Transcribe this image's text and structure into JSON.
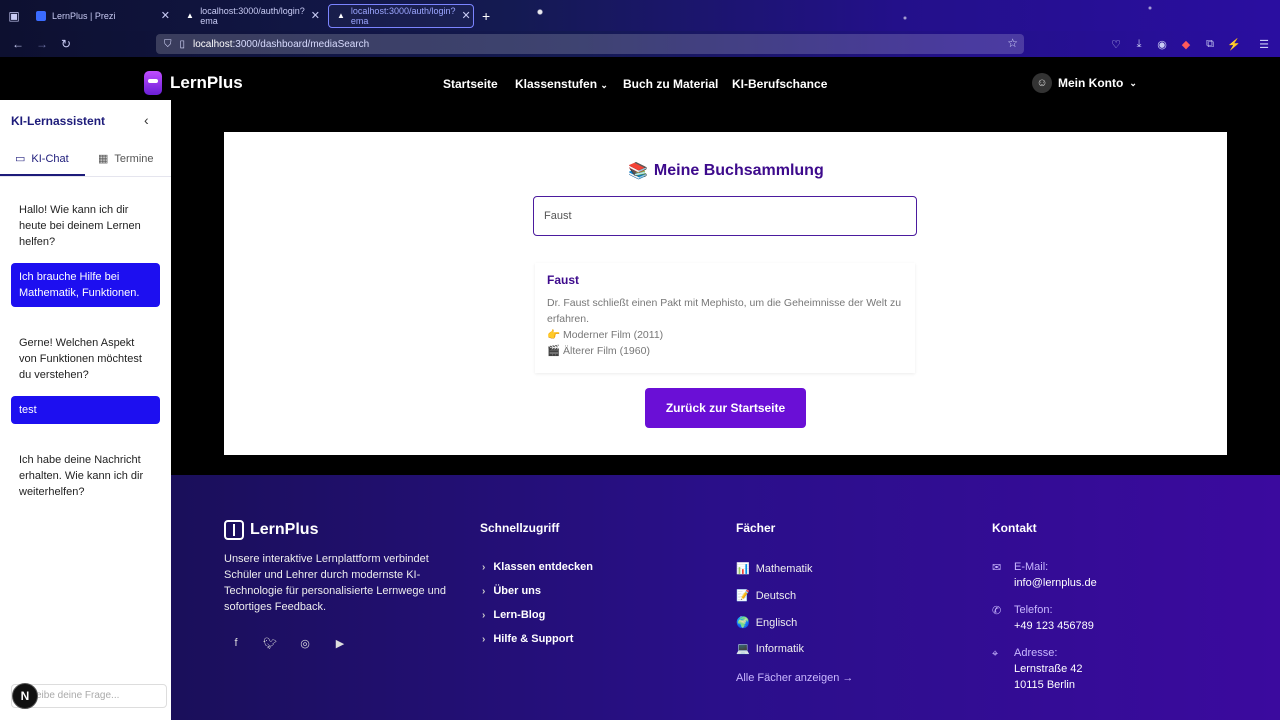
{
  "browser": {
    "tabs": [
      {
        "label": "LernPlus | Prezi",
        "active": false
      },
      {
        "label": "localhost:3000/auth/login?ema",
        "active": false
      },
      {
        "label": "localhost:3000/auth/login?ema",
        "active": true
      }
    ],
    "url_host": "localhost",
    "url_path": ":3000/dashboard/mediaSearch",
    "colors": {
      "chrome": "#141a52",
      "tab_active_border": "#7b84ff"
    }
  },
  "header": {
    "brand": "LernPlus",
    "nav": [
      "Startseite",
      "Klassenstufen",
      "Buch zu Material",
      "KI-Berufschance"
    ],
    "account": "Mein Konto"
  },
  "sidebar": {
    "title": "KI-Lernassistent",
    "tabs": [
      "KI-Chat",
      "Termine"
    ],
    "messages": [
      {
        "role": "bot",
        "text": "Hallo! Wie kann ich dir heute bei deinem Lernen helfen?"
      },
      {
        "role": "user",
        "text": "Ich brauche Hilfe bei Mathematik, Funktionen."
      },
      {
        "role": "bot",
        "text": "Gerne! Welchen Aspekt von Funktionen möchtest du verstehen?"
      },
      {
        "role": "user",
        "text": "test"
      },
      {
        "role": "bot",
        "text": "Ich habe deine Nachricht erhalten. Wie kann ich dir weiterhelfen?"
      }
    ],
    "input_placeholder": "eibe deine Frage...",
    "badge": "N"
  },
  "main": {
    "title_emoji": "📚",
    "title": "Meine Buchsammlung",
    "search_value": "Faust",
    "result": {
      "title": "Faust",
      "description": "Dr. Faust schließt einen Pakt mit Mephisto, um die Geheimnisse der Welt zu erfahren.",
      "film_modern_emoji": "👉",
      "film_modern": "Moderner Film (2011)",
      "film_old_emoji": "🎬",
      "film_old": "Älterer Film (1960)"
    },
    "back_button": "Zurück zur Startseite",
    "colors": {
      "accent": "#6a0fd6",
      "title": "#3d0a8c"
    }
  },
  "footer": {
    "brand": "LernPlus",
    "description": "Unsere interaktive Lernplattform verbindet Schüler und Lehrer durch modernste KI-Technologie für personalisierte Lernwege und sofortiges Feedback.",
    "social_icons": [
      "facebook-icon",
      "twitter-icon",
      "instagram-icon",
      "youtube-icon"
    ],
    "quick": {
      "heading": "Schnellzugriff",
      "links": [
        "Klassen entdecken",
        "Über uns",
        "Lern-Blog",
        "Hilfe & Support"
      ]
    },
    "subjects": {
      "heading": "Fächer",
      "items": [
        {
          "emoji": "📊",
          "label": "Mathematik"
        },
        {
          "emoji": "📝",
          "label": "Deutsch"
        },
        {
          "emoji": "🌍",
          "label": "Englisch"
        },
        {
          "emoji": "💻",
          "label": "Informatik"
        }
      ],
      "all_link": "Alle Fächer anzeigen →"
    },
    "contact": {
      "heading": "Kontakt",
      "email_label": "E-Mail:",
      "email": "info@lernplus.de",
      "phone_label": "Telefon:",
      "phone": "+49 123 456789",
      "address_label": "Adresse:",
      "address_line1": "Lernstraße 42",
      "address_line2": "10115 Berlin"
    }
  }
}
